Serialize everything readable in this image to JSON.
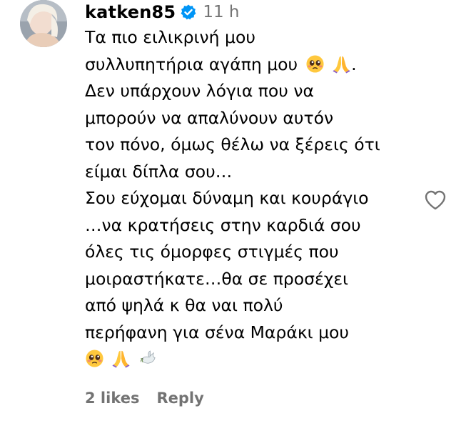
{
  "comment": {
    "username": "katken85",
    "timestamp": "11 h",
    "lines": {
      "l1": "Τα πιο ειλικρινή μου",
      "l2": "συλλυπητήρια αγάπη μου",
      "l2_tail": ".",
      "l3": "Δεν υπάρχουν λόγια που να",
      "l4": "μπορούν να απαλύνουν αυτόν",
      "l5": "τον πόνο, όμως θέλω να ξέρεις ότι",
      "l6": "είμαι δίπλα σου…",
      "l7": "Σου εύχομαι δύναμη και κουράγιο",
      "l8": "…να κρατήσεις στην καρδιά σου",
      "l9": "όλες τις όμορφες στιγμές που",
      "l10": "μοιραστήκατε…θα σε προσέχει",
      "l11": "από ψηλά κ θα ναι πολύ",
      "l12": "περήφανη για σένα Μαράκι μου"
    },
    "emojis": {
      "l2": [
        "pleading-face-icon",
        "folded-hands-icon"
      ],
      "l13": [
        "pleading-face-icon",
        "folded-hands-icon",
        "dove-icon"
      ]
    },
    "likes_label": "2 likes",
    "reply_label": "Reply"
  },
  "colors": {
    "text": "#000000",
    "secondary_text": "#737373",
    "verified_badge": "#0095f6",
    "heart_outline": "#737373"
  },
  "icons": {
    "verified": "verified-badge-icon",
    "like": "heart-outline-icon"
  }
}
